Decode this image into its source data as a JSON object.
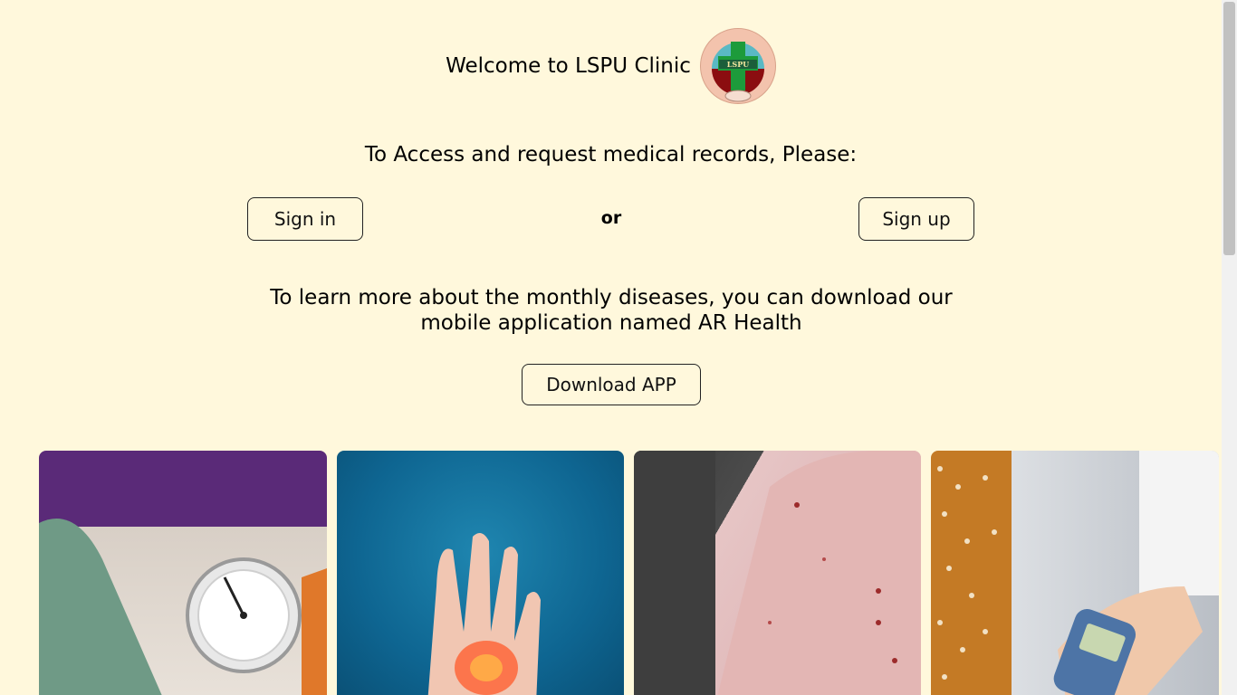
{
  "header": {
    "title": "Welcome to LSPU Clinic",
    "logo_text": "LSPU"
  },
  "access": {
    "prompt": "To Access and request medical records, Please:",
    "signin_label": "Sign in",
    "or_label": "or",
    "signup_label": "Sign up"
  },
  "learn": {
    "text": "To learn more about the monthly diseases, you can download our mobile application named AR Health",
    "download_label": "Download APP"
  },
  "cards": [
    {
      "icon": "blood-pressure-gauge-image"
    },
    {
      "icon": "joint-pain-hand-image"
    },
    {
      "icon": "skin-bites-arm-image"
    },
    {
      "icon": "glucose-meter-image"
    }
  ],
  "colors": {
    "background": "#fff8dc",
    "button_border": "#222222"
  }
}
